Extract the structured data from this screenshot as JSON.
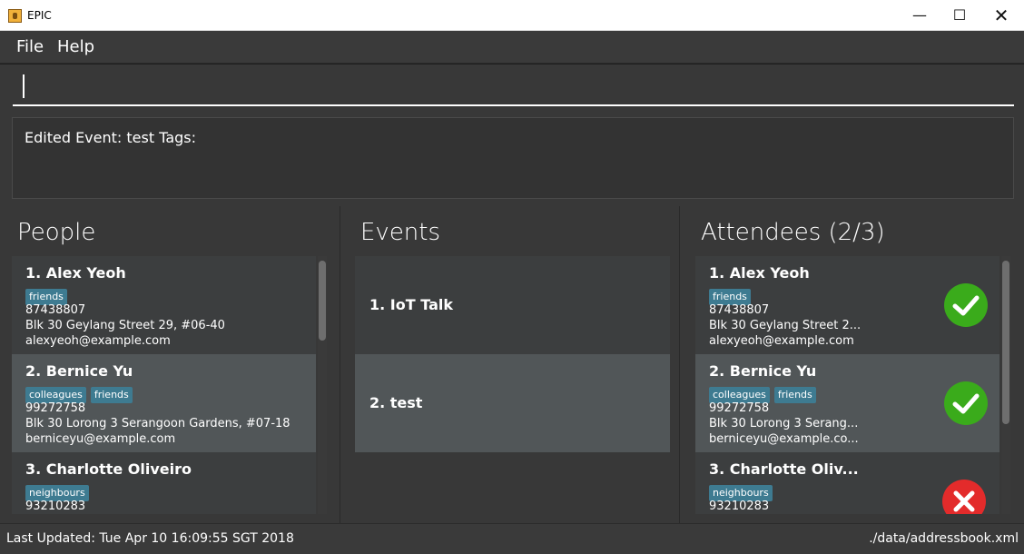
{
  "window": {
    "title": "EPIC",
    "minimize_glyph": "—",
    "maximize_glyph": "☐",
    "close_glyph": "✕"
  },
  "menu": [
    "File",
    "Help"
  ],
  "command": {
    "value": ""
  },
  "result": {
    "text": "Edited Event: test Tags:"
  },
  "people": {
    "title": "People",
    "items": [
      {
        "name": "1.  Alex Yeoh",
        "tags": [
          "friends"
        ],
        "phone": "87438807",
        "address": "Blk 30 Geylang Street 29, #06-40",
        "email": "alexyeoh@example.com"
      },
      {
        "name": "2.  Bernice Yu",
        "tags": [
          "colleagues",
          "friends"
        ],
        "phone": "99272758",
        "address": "Blk 30 Lorong 3 Serangoon Gardens, #07-18",
        "email": "berniceyu@example.com"
      },
      {
        "name": "3.  Charlotte Oliveiro",
        "tags": [
          "neighbours"
        ],
        "phone": "93210283",
        "address": "",
        "email": ""
      }
    ]
  },
  "events": {
    "title": "Events",
    "items": [
      {
        "name": "1.  IoT Talk"
      },
      {
        "name": "2.  test"
      }
    ]
  },
  "attendees": {
    "title": "Attendees (2/3)",
    "items": [
      {
        "name": "1.  Alex Yeoh",
        "tags": [
          "friends"
        ],
        "phone": "87438807",
        "address": "Blk 30 Geylang Street 2...",
        "email": "alexyeoh@example.com",
        "status": "attending",
        "status_icon": "check-icon"
      },
      {
        "name": "2.  Bernice Yu",
        "tags": [
          "colleagues",
          "friends"
        ],
        "phone": "99272758",
        "address": "Blk 30 Lorong 3 Serang...",
        "email": "berniceyu@example.co...",
        "status": "attending",
        "status_icon": "check-icon"
      },
      {
        "name": "3.  Charlotte Oliv...",
        "tags": [
          "neighbours"
        ],
        "phone": "93210283",
        "address": "",
        "email": "",
        "status": "not-attending",
        "status_icon": "cross-icon"
      }
    ]
  },
  "status": {
    "last_updated": "Last Updated: Tue Apr 10 16:09:55 SGT 2018",
    "file": "./data/addressbook.xml"
  },
  "colors": {
    "background": "#383838",
    "card_odd": "#3c3e3f",
    "card_selected": "#515658",
    "tag": "#3e7b91",
    "ok": "#3aab1b",
    "no": "#e32b2b"
  }
}
